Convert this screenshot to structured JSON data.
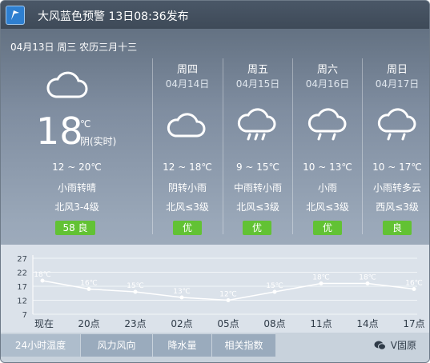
{
  "app": {
    "title": "大风蓝色预警 13日08:36发布",
    "icon": "app-logo-icon"
  },
  "today": {
    "date": "04月13日 周三 农历三月十三",
    "icon": "cloud-icon",
    "temp": "18",
    "unit": "℃",
    "weather": "阴(实时)",
    "range": "12 ~ 20℃",
    "desc": "小雨转晴",
    "wind": "北风3-4级",
    "aqi": "58 良"
  },
  "forecast": [
    {
      "weekday": "周四",
      "date": "04月14日",
      "icon": "cloud-icon",
      "range": "12 ~ 18℃",
      "desc": "阴转小雨",
      "wind": "北风≤3级",
      "aqi": "优"
    },
    {
      "weekday": "周五",
      "date": "04月15日",
      "icon": "rain-cloud-icon",
      "range": "9 ~ 15℃",
      "desc": "中雨转小雨",
      "wind": "北风≤3级",
      "aqi": "优"
    },
    {
      "weekday": "周六",
      "date": "04月16日",
      "icon": "rain-cloud-icon",
      "range": "10 ~ 13℃",
      "desc": "小雨",
      "wind": "北风≤3级",
      "aqi": "优"
    },
    {
      "weekday": "周日",
      "date": "04月17日",
      "icon": "rain-cloud-icon",
      "range": "10 ~ 17℃",
      "desc": "小雨转多云",
      "wind": "西风≤3级",
      "aqi": "良"
    }
  ],
  "chart_data": {
    "type": "line",
    "categories": [
      "现在",
      "",
      "20点",
      "",
      "23点",
      "",
      "02点",
      "",
      "05点",
      "",
      "08点",
      "",
      "11点",
      "",
      "14点",
      "",
      "17点"
    ],
    "tick_labels": [
      "现在",
      "20点",
      "23点",
      "02点",
      "05点",
      "08点",
      "11点",
      "14点",
      "17点"
    ],
    "values": [
      19,
      16,
      15,
      13,
      12,
      15,
      18,
      18,
      16
    ],
    "value_labels": [
      "18℃",
      "16℃",
      "15℃",
      "13℃",
      "12℃",
      "15℃",
      "18℃",
      "18℃",
      "16℃"
    ],
    "y_ticks": [
      "27",
      "22",
      "17",
      "12",
      "7"
    ],
    "ylim": [
      7,
      27
    ],
    "grid": true
  },
  "tabs": [
    {
      "label": "24小时温度",
      "active": true
    },
    {
      "label": "风力风向",
      "active": false
    },
    {
      "label": "降水量",
      "active": false
    },
    {
      "label": "相关指数",
      "active": false
    }
  ],
  "footer": {
    "brand": "V固原",
    "icon": "wechat-icon"
  },
  "colors": {
    "aqi_good": "#62c234",
    "line": "#ffffff"
  }
}
